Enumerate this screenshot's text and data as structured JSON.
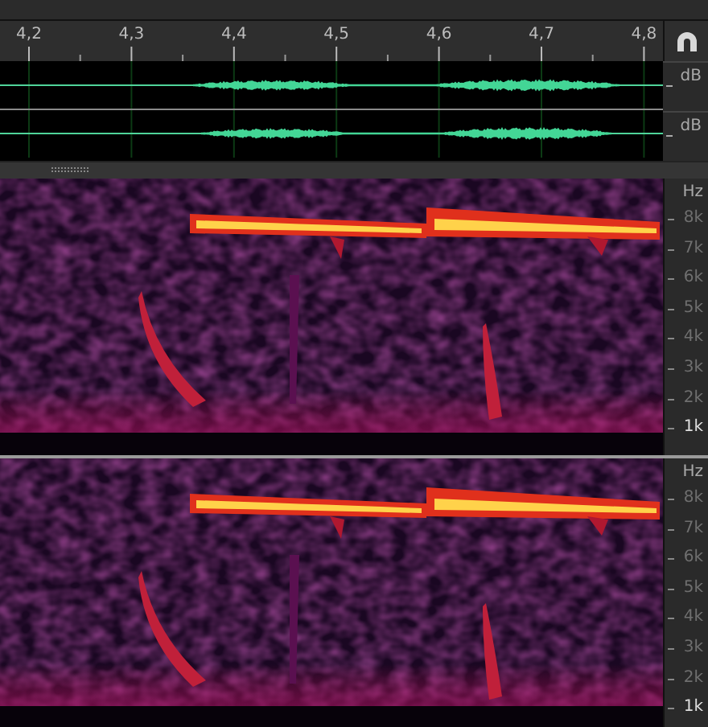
{
  "ruler": {
    "ticks": [
      "4,2",
      "4,3",
      "4,4",
      "4,5",
      "4,6",
      "4,7",
      "4,8"
    ]
  },
  "waveform": {
    "channels": [
      {
        "unit": "dB"
      },
      {
        "unit": "dB"
      }
    ]
  },
  "spectrograms": [
    {
      "unit": "Hz",
      "labels": [
        {
          "text": "8k",
          "emphasized": false
        },
        {
          "text": "7k",
          "emphasized": false
        },
        {
          "text": "6k",
          "emphasized": false
        },
        {
          "text": "5k",
          "emphasized": false
        },
        {
          "text": "4k",
          "emphasized": false
        },
        {
          "text": "3k",
          "emphasized": false
        },
        {
          "text": "2k",
          "emphasized": false
        },
        {
          "text": "1k",
          "emphasized": true
        }
      ]
    },
    {
      "unit": "Hz",
      "labels": [
        {
          "text": "8k",
          "emphasized": false
        },
        {
          "text": "7k",
          "emphasized": false
        },
        {
          "text": "6k",
          "emphasized": false
        },
        {
          "text": "5k",
          "emphasized": false
        },
        {
          "text": "4k",
          "emphasized": false
        },
        {
          "text": "3k",
          "emphasized": false
        },
        {
          "text": "2k",
          "emphasized": false
        },
        {
          "text": "1k",
          "emphasized": true
        }
      ]
    }
  ]
}
